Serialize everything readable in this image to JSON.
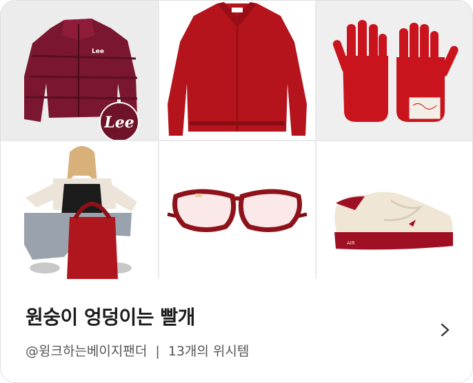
{
  "collection": {
    "title": "원숭이 엉덩이는 빨개",
    "author": "@윙크하는베이지팬더",
    "separator": "|",
    "item_count_label": "13개의 위시템",
    "lee_badge_text": "Lee"
  },
  "products": [
    {
      "icon": "puffer-jacket-image"
    },
    {
      "icon": "red-jacket-image"
    },
    {
      "icon": "red-gloves-image"
    },
    {
      "icon": "model-with-red-bag-image"
    },
    {
      "icon": "red-glasses-image"
    },
    {
      "icon": "sneaker-image"
    }
  ],
  "colors": {
    "accent_red": "#b5141c",
    "burgundy": "#7a1630"
  }
}
